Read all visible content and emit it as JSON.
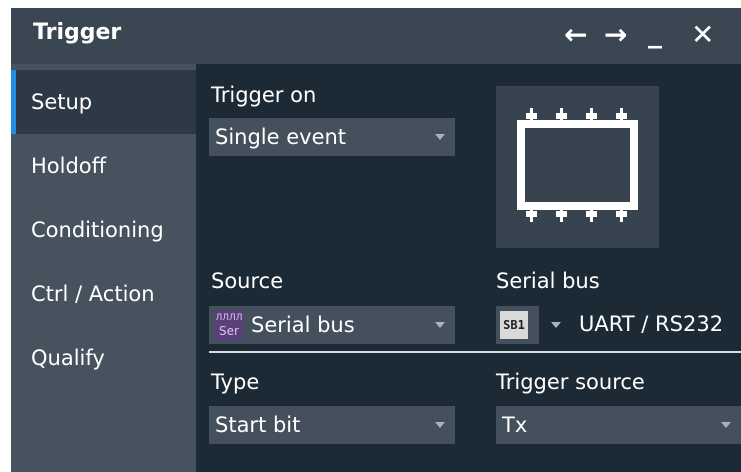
{
  "window": {
    "title": "Trigger"
  },
  "sidebar": {
    "items": [
      {
        "label": "Setup"
      },
      {
        "label": "Holdoff"
      },
      {
        "label": "Conditioning"
      },
      {
        "label": "Ctrl / Action"
      },
      {
        "label": "Qualify"
      }
    ]
  },
  "setup": {
    "trigger_on": {
      "label": "Trigger on",
      "value": "Single event"
    },
    "source": {
      "label": "Source",
      "value": "Serial bus",
      "icon_text_top": "ЛЛЛЛ",
      "icon_text_bottom": "Ser"
    },
    "serial_bus": {
      "label": "Serial bus",
      "bus": "SB1",
      "protocol": "UART / RS232"
    },
    "type": {
      "label": "Type",
      "value": "Start bit"
    },
    "trigger_source": {
      "label": "Trigger source",
      "value": "Tx"
    }
  },
  "colors": {
    "accent": "#1f8fe6",
    "background": "#1c2a35",
    "sidebar": "#46525d",
    "titlebar": "#3a4652"
  }
}
